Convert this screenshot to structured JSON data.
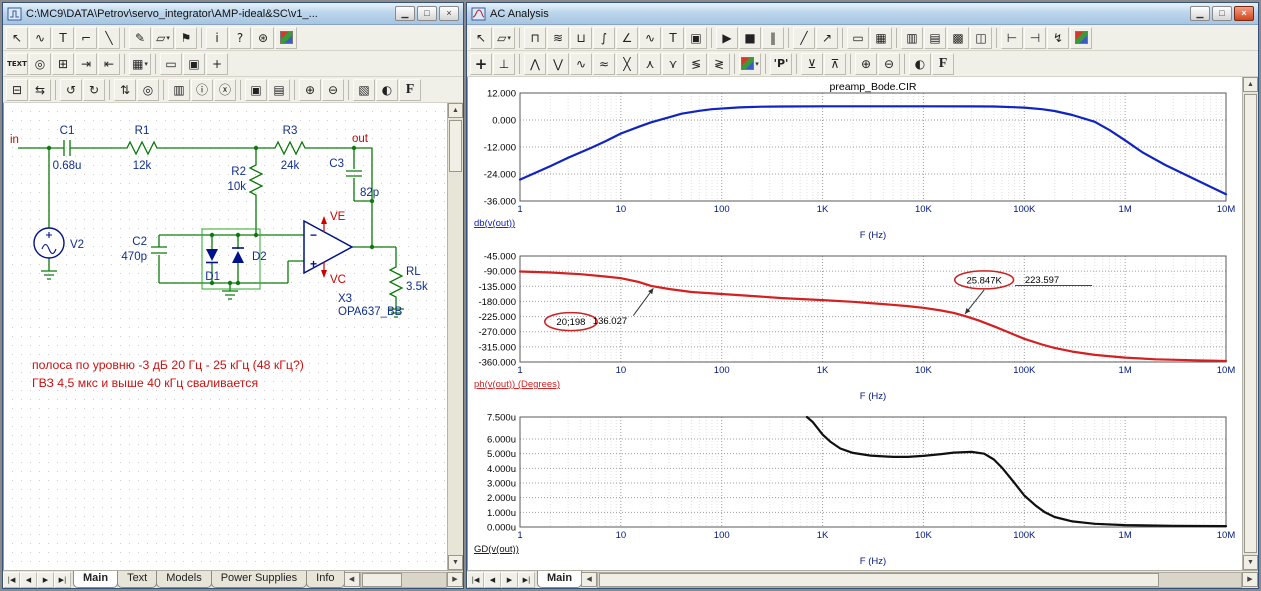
{
  "left_window": {
    "title": "C:\\MC9\\DATA\\Petrov\\servo_integrator\\AMP-ideal&SC\\v1_...",
    "window_buttons": {
      "minimize": "▁",
      "maximize": "□",
      "close": "×"
    },
    "toolbar1": [
      {
        "n": "select-tool",
        "g": "↖"
      },
      {
        "n": "component-tool",
        "g": "∿"
      },
      {
        "n": "text-tool",
        "g": "T"
      },
      {
        "n": "wire-tool",
        "g": "⌐"
      },
      {
        "n": "diagonal-wire-tool",
        "g": "╲"
      },
      {
        "sep": 1
      },
      {
        "n": "line-tool",
        "g": "✎"
      },
      {
        "n": "shape-tool",
        "g": "▱",
        "dd": 1
      },
      {
        "n": "flag-tool",
        "g": "⚑"
      },
      {
        "sep": 1
      },
      {
        "n": "info-tool",
        "g": "i"
      },
      {
        "n": "help-mode-tool",
        "g": "?"
      },
      {
        "n": "settings-tool",
        "g": "⊛"
      },
      {
        "n": "color-palette-tool",
        "g": "",
        "cls": "colorbox"
      }
    ],
    "toolbar2": [
      {
        "n": "text-display-toggle",
        "g": "TEXT",
        "cls": "texty"
      },
      {
        "n": "pin-connections-toggle",
        "g": "◎"
      },
      {
        "n": "node-numbers-toggle",
        "g": "⊞"
      },
      {
        "n": "node-voltages-toggle",
        "g": "⇥"
      },
      {
        "n": "currents-toggle",
        "g": "⇤"
      },
      {
        "sep": 1
      },
      {
        "n": "grid-toggle",
        "g": "▦",
        "dd": 1
      },
      {
        "sep": 1
      },
      {
        "n": "border-toggle",
        "g": "▭"
      },
      {
        "n": "title-block-toggle",
        "g": "▣"
      },
      {
        "n": "cursor-mode-toggle",
        "g": "+"
      }
    ],
    "toolbar3": [
      {
        "n": "box-tool",
        "g": "⊟"
      },
      {
        "n": "swap-tool",
        "g": "⇆"
      },
      {
        "sep": 1
      },
      {
        "n": "undo-button",
        "g": "↺"
      },
      {
        "n": "redo-button",
        "g": "↻"
      },
      {
        "sep": 1
      },
      {
        "n": "step-box-button",
        "g": "⇅"
      },
      {
        "n": "find-button",
        "g": "◎"
      },
      {
        "sep": 1
      },
      {
        "n": "mode-button",
        "g": "▥"
      },
      {
        "n": "info-button",
        "g": "ⓘ"
      },
      {
        "n": "clear-button",
        "g": "ⓧ"
      },
      {
        "sep": 1
      },
      {
        "n": "copy-picture-button",
        "g": "▣"
      },
      {
        "n": "layers-button",
        "g": "▤"
      },
      {
        "sep": 1
      },
      {
        "n": "zoom-in-button",
        "g": "⊕"
      },
      {
        "n": "zoom-out-button",
        "g": "⊖"
      },
      {
        "sep": 1
      },
      {
        "n": "camera-button",
        "g": "▧"
      },
      {
        "n": "help-globe-button",
        "g": "◐"
      },
      {
        "n": "font-button",
        "g": "F",
        "cls": "serif"
      }
    ],
    "tab_nav": [
      {
        "n": "first-tab",
        "g": "|◀"
      },
      {
        "n": "prev-tab",
        "g": "◀"
      },
      {
        "n": "next-tab",
        "g": "▶"
      },
      {
        "n": "last-tab",
        "g": "▶|"
      }
    ],
    "tabs": [
      "Main",
      "Text",
      "Models",
      "Power Supplies",
      "Info"
    ],
    "scroll": {
      "up": "▲",
      "down": "▼",
      "left": "◀",
      "right": "▶"
    },
    "schematic": {
      "in_label": "in",
      "out_label": "out",
      "ve_label": "VE",
      "vc_label": "VC",
      "c1": {
        "name": "C1",
        "value": "0.68u"
      },
      "r1": {
        "name": "R1",
        "value": "12k"
      },
      "r2": {
        "name": "R2",
        "value": "10k"
      },
      "r3": {
        "name": "R3",
        "value": "24k"
      },
      "c2": {
        "name": "C2",
        "value": "470p"
      },
      "c3": {
        "name": "C3",
        "value": "82p"
      },
      "d1": "D1",
      "d2": "D2",
      "v2": "V2",
      "opamp": {
        "name": "X3",
        "model": "OPA637_BB",
        "minus": "−",
        "plus": "+"
      },
      "rl": {
        "name": "RL",
        "value": "3.5k"
      },
      "note1": "полоса по уровню -3 дБ 20 Гц - 25 кГц (48 кГц?)",
      "note2": "ГВЗ 4,5 мкс и выше 40 кГц сваливается"
    }
  },
  "right_window": {
    "title": "AC Analysis",
    "window_buttons": {
      "minimize": "▁",
      "maximize": "□",
      "close": "×"
    },
    "toolbar1": [
      {
        "n": "select-tool",
        "g": "↖"
      },
      {
        "n": "graphics-dropdown",
        "g": "▱",
        "dd": 1
      },
      {
        "sep": 1
      },
      {
        "n": "measure-horizontal-tool",
        "g": "⊓"
      },
      {
        "n": "measure-vertical-tool",
        "g": "≋"
      },
      {
        "n": "ruler-tool",
        "g": "⊔"
      },
      {
        "n": "integral-tool",
        "g": "∫"
      },
      {
        "n": "slope-tool",
        "g": "∠"
      },
      {
        "n": "waveform-tool",
        "g": "∿"
      },
      {
        "n": "text-tool",
        "g": "T"
      },
      {
        "n": "copy-button",
        "g": "▣"
      },
      {
        "sep": 1
      },
      {
        "n": "run-button",
        "g": "▶"
      },
      {
        "n": "stop-button",
        "g": "■"
      },
      {
        "n": "pause-button",
        "g": "‖"
      },
      {
        "sep": 1
      },
      {
        "n": "line-tool",
        "g": "╱"
      },
      {
        "n": "arrow-tool",
        "g": "↗"
      },
      {
        "sep": 1
      },
      {
        "n": "rectangle-tool",
        "g": "▭"
      },
      {
        "n": "grid-squares-toggle",
        "g": "▦"
      },
      {
        "sep": 1
      },
      {
        "n": "vertical-grid-toggle",
        "g": "▥"
      },
      {
        "n": "horizontal-grid-toggle",
        "g": "▤"
      },
      {
        "n": "full-grid-toggle",
        "g": "▩"
      },
      {
        "n": "split-plots-toggle",
        "g": "◫"
      },
      {
        "sep": 1
      },
      {
        "n": "exclude-left-button",
        "g": "⊢"
      },
      {
        "n": "exclude-right-button",
        "g": "⊣"
      },
      {
        "n": "tag-mode-button",
        "g": "↯"
      },
      {
        "n": "color-settings-button",
        "g": "",
        "cls": "colorbox"
      }
    ],
    "toolbar2": [
      {
        "n": "cursor-mode-button",
        "g": "+",
        "cls": "big"
      },
      {
        "n": "go-to-x-button",
        "g": "⊥"
      },
      {
        "sep": 1
      },
      {
        "n": "next-peak-button",
        "g": "⋀"
      },
      {
        "n": "next-valley-button",
        "g": "⋁"
      },
      {
        "n": "next-wave-button",
        "g": "∿"
      },
      {
        "n": "smooth-button",
        "g": "≈"
      },
      {
        "n": "cross-cursor-button",
        "g": "╳"
      },
      {
        "n": "global-high-button",
        "g": "⋏"
      },
      {
        "n": "global-low-button",
        "g": "⋎"
      },
      {
        "n": "envelope-low-button",
        "g": "≶"
      },
      {
        "n": "envelope-high-button",
        "g": "≷"
      },
      {
        "sep": 1
      },
      {
        "n": "trace-color-dropdown",
        "g": "",
        "cls": "colorbox",
        "dd": 1
      },
      {
        "sep": 1
      },
      {
        "n": "peak-label-button",
        "g": "'P'",
        "cls": "texty2"
      },
      {
        "sep": 1
      },
      {
        "n": "cursor-left-button",
        "g": "⊻"
      },
      {
        "n": "cursor-right-button",
        "g": "⊼"
      },
      {
        "sep": 1
      },
      {
        "n": "zoom-in-button",
        "g": "⊕"
      },
      {
        "n": "zoom-out-button",
        "g": "⊖"
      },
      {
        "sep": 1
      },
      {
        "n": "help-globe-button",
        "g": "◐"
      },
      {
        "n": "font-button",
        "g": "F",
        "cls": "serif"
      }
    ],
    "tab_nav": [
      {
        "n": "first-tab",
        "g": "|◀"
      },
      {
        "n": "prev-tab",
        "g": "◀"
      },
      {
        "n": "next-tab",
        "g": "▶"
      },
      {
        "n": "last-tab",
        "g": "▶|"
      }
    ],
    "tabs": [
      "Main"
    ],
    "scroll": {
      "up": "▲",
      "down": "▼",
      "left": "◀",
      "right": "▶"
    }
  },
  "chart_data": [
    {
      "type": "line",
      "title": "preamp_Bode.CIR",
      "legend": "db(v(out))",
      "xlabel": "F (Hz)",
      "x_scale": "log",
      "xlim": [
        1,
        10000000
      ],
      "x_tick_labels": [
        "1",
        "10",
        "100",
        "1K",
        "10K",
        "100K",
        "1M",
        "10M"
      ],
      "ylim": [
        -36,
        12
      ],
      "y_ticks": [
        12,
        0,
        -12,
        -24,
        -36
      ],
      "y_tick_labels": [
        "12.000",
        "0.000",
        "-12.000",
        "-24.000",
        "-36.000"
      ],
      "grid": true,
      "color": "#1024c0",
      "points": [
        [
          1,
          -26.5
        ],
        [
          2,
          -20.5
        ],
        [
          3,
          -16.8
        ],
        [
          5,
          -12.5
        ],
        [
          7,
          -9.5
        ],
        [
          10,
          -6
        ],
        [
          15,
          -3
        ],
        [
          20,
          -1
        ],
        [
          30,
          1.2
        ],
        [
          40,
          2.8
        ],
        [
          60,
          4.1
        ],
        [
          80,
          4.8
        ],
        [
          150,
          5.6
        ],
        [
          250,
          5.9
        ],
        [
          400,
          6.0
        ],
        [
          1000,
          6.1
        ],
        [
          3000,
          6.1
        ],
        [
          10000,
          6.1
        ],
        [
          30000,
          6.05
        ],
        [
          50000,
          6.0
        ],
        [
          100000,
          5.5
        ],
        [
          150000,
          4.8
        ],
        [
          200000,
          4.0
        ],
        [
          300000,
          2.2
        ],
        [
          500000,
          -0.8
        ],
        [
          700000,
          -4.5
        ],
        [
          1000000,
          -9
        ],
        [
          1500000,
          -14.5
        ],
        [
          2500000,
          -20
        ],
        [
          5000000,
          -26.5
        ],
        [
          10000000,
          -33
        ]
      ]
    },
    {
      "type": "line",
      "title": "",
      "legend": "ph(v(out)) (Degrees)",
      "xlabel": "F (Hz)",
      "x_scale": "log",
      "xlim": [
        1,
        10000000
      ],
      "x_tick_labels": [
        "1",
        "10",
        "100",
        "1K",
        "10K",
        "100K",
        "1M",
        "10M"
      ],
      "ylim": [
        -360,
        -45
      ],
      "y_ticks": [
        -45,
        -90,
        -135,
        -180,
        -225,
        -270,
        -315,
        -360
      ],
      "y_tick_labels": [
        "-45.000",
        "-90.000",
        "-135.000",
        "-180.000",
        "-225.000",
        "-270.000",
        "-315.000",
        "-360.000"
      ],
      "grid": true,
      "color": "#d42020",
      "points": [
        [
          1,
          -91
        ],
        [
          2,
          -94
        ],
        [
          4,
          -99
        ],
        [
          7,
          -106
        ],
        [
          10,
          -111
        ],
        [
          15,
          -122
        ],
        [
          20,
          -134
        ],
        [
          30,
          -143
        ],
        [
          50,
          -152
        ],
        [
          100,
          -158
        ],
        [
          200,
          -164
        ],
        [
          400,
          -170
        ],
        [
          1000,
          -176
        ],
        [
          2000,
          -181
        ],
        [
          4000,
          -188
        ],
        [
          7000,
          -194
        ],
        [
          10000,
          -199
        ],
        [
          15000,
          -207
        ],
        [
          20000,
          -214
        ],
        [
          25847,
          -223.6
        ],
        [
          35000,
          -236
        ],
        [
          50000,
          -254
        ],
        [
          70000,
          -272
        ],
        [
          100000,
          -291
        ],
        [
          150000,
          -308
        ],
        [
          200000,
          -318
        ],
        [
          300000,
          -329
        ],
        [
          500000,
          -339
        ],
        [
          1000000,
          -347
        ],
        [
          2000000,
          -352
        ],
        [
          5000000,
          -355
        ],
        [
          10000000,
          -357
        ]
      ],
      "annotations": [
        {
          "label": "20;198",
          "value": "136.027",
          "label_at": [
            3.2,
            -240
          ],
          "value_at": [
            7.8,
            -237
          ],
          "target": [
            21,
            -141
          ],
          "leader_from": "value"
        },
        {
          "label": "25.847K",
          "value": "223.597",
          "label_at": [
            40000,
            -116
          ],
          "value_at": [
            150000,
            -115
          ],
          "target": [
            25847,
            -217
          ],
          "leader_from": "label",
          "underline_value": true
        }
      ]
    },
    {
      "type": "line",
      "title": "",
      "legend": "GD(v(out))",
      "xlabel": "F (Hz)",
      "x_scale": "log",
      "xlim": [
        1,
        10000000
      ],
      "x_tick_labels": [
        "1",
        "10",
        "100",
        "1K",
        "10K",
        "100K",
        "1M",
        "10M"
      ],
      "ylim": [
        0,
        7.5
      ],
      "y_unit": "u (microseconds)",
      "y_ticks": [
        7.5,
        6,
        5,
        4,
        3,
        2,
        1,
        0
      ],
      "y_tick_labels": [
        "7.500u",
        "6.000u",
        "5.000u",
        "4.000u",
        "3.000u",
        "2.000u",
        "1.000u",
        "0.000u"
      ],
      "grid": true,
      "color": "#101010",
      "points": [
        [
          700,
          7.5
        ],
        [
          800,
          7.15
        ],
        [
          900,
          6.7
        ],
        [
          1000,
          6.3
        ],
        [
          1200,
          5.8
        ],
        [
          1500,
          5.35
        ],
        [
          2000,
          5.05
        ],
        [
          3000,
          4.87
        ],
        [
          5000,
          4.78
        ],
        [
          7000,
          4.78
        ],
        [
          10000,
          4.85
        ],
        [
          15000,
          4.97
        ],
        [
          20000,
          5.07
        ],
        [
          30000,
          5.12
        ],
        [
          40000,
          5.0
        ],
        [
          50000,
          4.6
        ],
        [
          60000,
          4.05
        ],
        [
          80000,
          3.0
        ],
        [
          100000,
          2.15
        ],
        [
          130000,
          1.45
        ],
        [
          160000,
          1.0
        ],
        [
          200000,
          0.68
        ],
        [
          300000,
          0.38
        ],
        [
          500000,
          0.22
        ],
        [
          1000000,
          0.13
        ],
        [
          3000000,
          0.08
        ],
        [
          10000000,
          0.06
        ]
      ]
    }
  ]
}
